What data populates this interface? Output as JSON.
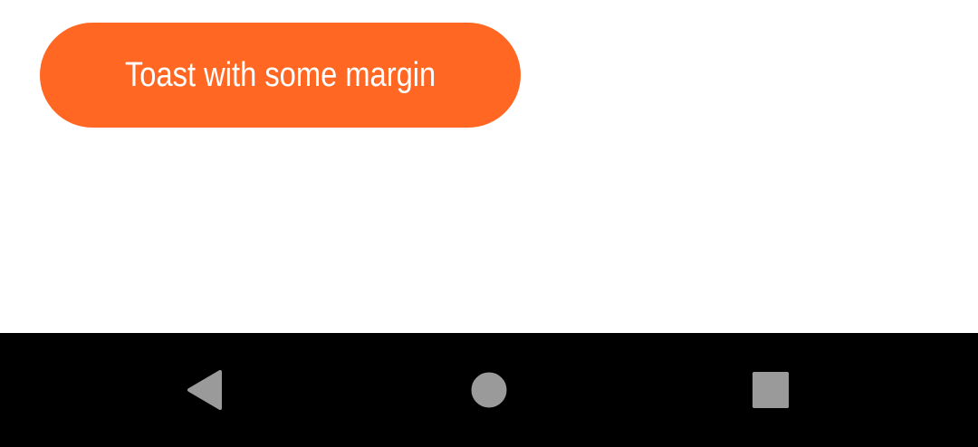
{
  "toast": {
    "message": "Toast with some margin",
    "background_color": "#FF6723",
    "text_color": "#FFFFFF"
  },
  "navigation_bar": {
    "background_color": "#000000",
    "icon_color": "#9A9A9A",
    "buttons": [
      {
        "name": "back",
        "icon": "back-triangle-icon"
      },
      {
        "name": "home",
        "icon": "home-circle-icon"
      },
      {
        "name": "recents",
        "icon": "recents-square-icon"
      }
    ]
  }
}
